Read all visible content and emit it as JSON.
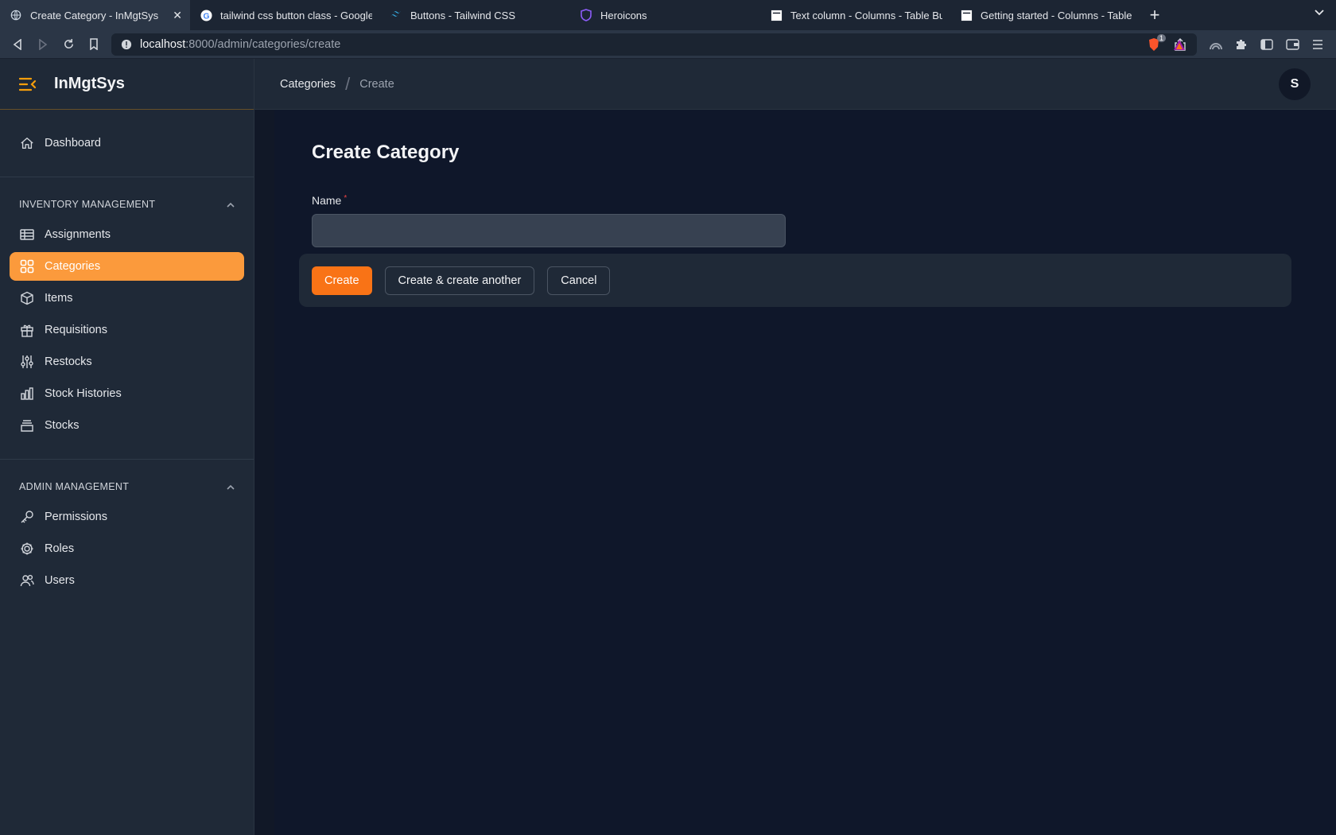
{
  "browser": {
    "tabs": [
      {
        "title": "Create Category - InMgtSys",
        "icon": "globe-icon"
      },
      {
        "title": "tailwind css button class - Google Search",
        "icon": "google-icon"
      },
      {
        "title": "Buttons - Tailwind CSS",
        "icon": "tailwind-icon"
      },
      {
        "title": "Heroicons",
        "icon": "shield-icon"
      },
      {
        "title": "Text column - Columns - Table Builder",
        "icon": "page-icon"
      },
      {
        "title": "Getting started - Columns - Table Builder",
        "icon": "page-icon"
      }
    ],
    "url_host": "localhost",
    "url_path": ":8000/admin/categories/create",
    "brave_badge": "1"
  },
  "app": {
    "brand": "InMgtSys",
    "avatar_initial": "S"
  },
  "sidebar": {
    "dashboard": "Dashboard",
    "groups": [
      {
        "label": "INVENTORY MANAGEMENT",
        "items": [
          "Assignments",
          "Categories",
          "Items",
          "Requisitions",
          "Restocks",
          "Stock Histories",
          "Stocks"
        ]
      },
      {
        "label": "ADMIN MANAGEMENT",
        "items": [
          "Permissions",
          "Roles",
          "Users"
        ]
      }
    ]
  },
  "breadcrumb": {
    "parent": "Categories",
    "current": "Create"
  },
  "form": {
    "title": "Create Category",
    "name_label": "Name",
    "required_mark": "*",
    "name_value": "",
    "create_label": "Create",
    "create_another_label": "Create & create another",
    "cancel_label": "Cancel"
  },
  "colors": {
    "accent": "#f97316",
    "active_nav": "#fb9a3c"
  }
}
